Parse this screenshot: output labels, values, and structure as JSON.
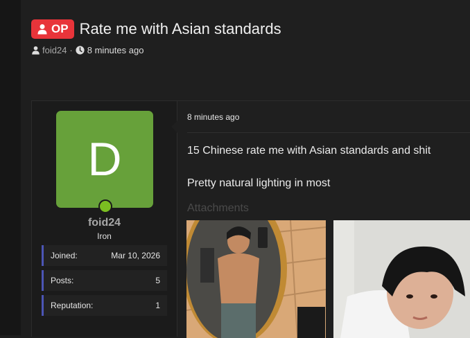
{
  "thread": {
    "badge_label": "OP",
    "title": "Rate me with Asian standards",
    "author": "foid24",
    "separator": "·",
    "time": "8 minutes ago"
  },
  "post": {
    "time": "8 minutes ago",
    "body_line1": "15 Chinese rate me with Asian standards and shit",
    "body_line2": "Pretty natural lighting in most",
    "attachments_label": "Attachments"
  },
  "user": {
    "avatar_letter": "D",
    "avatar_color": "#67a13a",
    "online_color": "#7bbe21",
    "name": "foid24",
    "rank": "Iron",
    "stats": [
      {
        "label": "Joined:",
        "value": "Mar 10, 2026"
      },
      {
        "label": "Posts:",
        "value": "5"
      },
      {
        "label": "Reputation:",
        "value": "1"
      }
    ]
  },
  "colors": {
    "background": "#1e1e1e",
    "op_badge": "#e8343a",
    "stat_accent": "#4c55b5"
  }
}
